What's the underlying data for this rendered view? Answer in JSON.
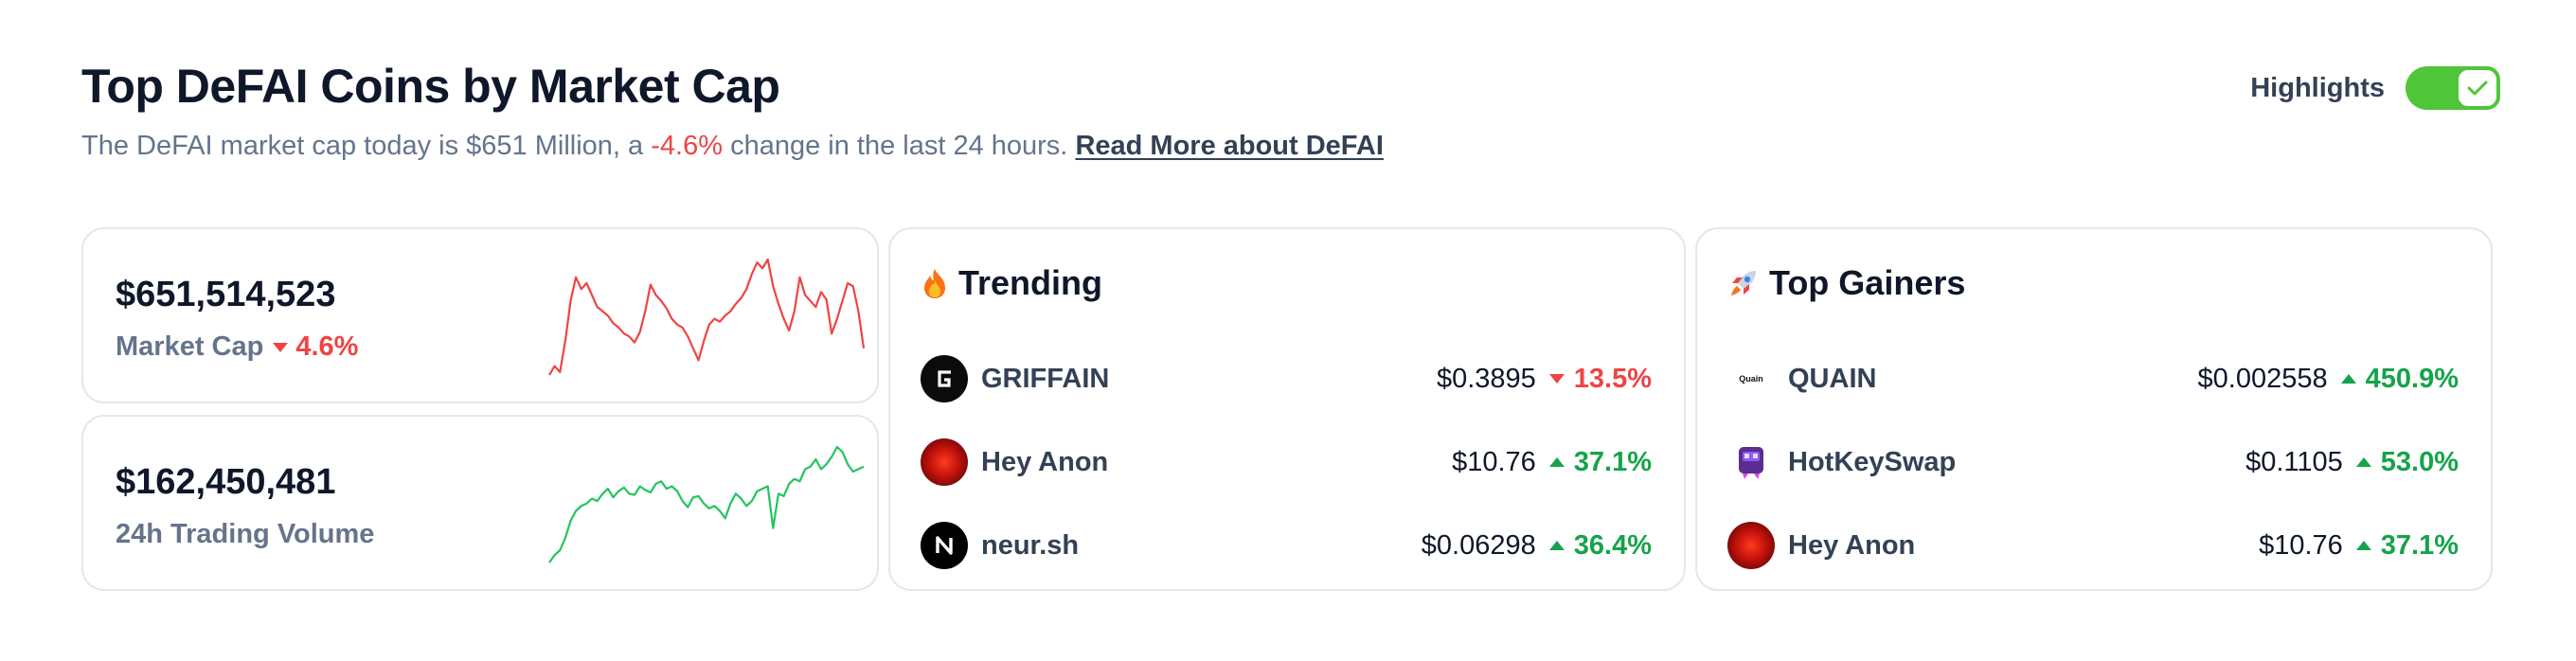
{
  "header": {
    "title": "Top DeFAI Coins by Market Cap",
    "subtitle_prefix": "The DeFAI market cap today is $651 Million, a",
    "subtitle_change": "-4.6%",
    "subtitle_suffix": "change in the last 24 hours.",
    "read_more_link": "Read More about DeFAI"
  },
  "highlights": {
    "label": "Highlights",
    "enabled": true
  },
  "colors": {
    "positive": "#16a34a",
    "negative": "#ef4444",
    "toggle_on": "#4fc53a",
    "text_muted": "#64748b"
  },
  "market_cap_card": {
    "value": "$651,514,523",
    "label": "Market Cap",
    "change": "4.6%",
    "direction": "down",
    "sparkline": [
      12,
      18,
      14,
      35,
      62,
      78,
      70,
      74,
      66,
      58,
      55,
      52,
      47,
      44,
      40,
      38,
      34,
      41,
      55,
      73,
      66,
      62,
      57,
      50,
      46,
      44,
      38,
      30,
      22,
      35,
      46,
      50,
      48,
      52,
      55,
      60,
      64,
      70,
      80,
      88,
      84,
      90,
      72,
      60,
      50,
      42,
      55,
      78,
      66,
      62,
      58,
      68,
      63,
      40,
      50,
      62,
      74,
      72,
      55,
      30
    ]
  },
  "volume_card": {
    "value": "$162,450,481",
    "label": "24h Trading Volume",
    "sparkline": [
      2,
      8,
      12,
      22,
      36,
      44,
      48,
      50,
      54,
      52,
      58,
      62,
      55,
      60,
      63,
      58,
      57,
      64,
      61,
      59,
      66,
      68,
      62,
      64,
      60,
      52,
      47,
      55,
      56,
      50,
      46,
      48,
      44,
      38,
      50,
      58,
      54,
      48,
      52,
      60,
      62,
      64,
      30,
      58,
      56,
      66,
      70,
      68,
      78,
      80,
      86,
      78,
      82,
      88,
      96,
      92,
      82,
      76,
      78,
      80
    ]
  },
  "trending": {
    "title": "Trending",
    "icon": "fire-icon",
    "rows": [
      {
        "name": "GRIFFAIN",
        "price": "$0.3895",
        "change": "13.5%",
        "direction": "down",
        "icon": "griffain-logo"
      },
      {
        "name": "Hey Anon",
        "price": "$10.76",
        "change": "37.1%",
        "direction": "up",
        "icon": "hey-anon-logo"
      },
      {
        "name": "neur.sh",
        "price": "$0.06298",
        "change": "36.4%",
        "direction": "up",
        "icon": "neur-logo"
      }
    ]
  },
  "top_gainers": {
    "title": "Top Gainers",
    "icon": "rocket-icon",
    "rows": [
      {
        "name": "QUAIN",
        "price": "$0.002558",
        "change": "450.9%",
        "direction": "up",
        "icon": "quain-logo",
        "logo_text": "Quain"
      },
      {
        "name": "HotKeySwap",
        "price": "$0.1105",
        "change": "53.0%",
        "direction": "up",
        "icon": "hotkeyswap-logo"
      },
      {
        "name": "Hey Anon",
        "price": "$10.76",
        "change": "37.1%",
        "direction": "up",
        "icon": "hey-anon-logo"
      }
    ]
  }
}
